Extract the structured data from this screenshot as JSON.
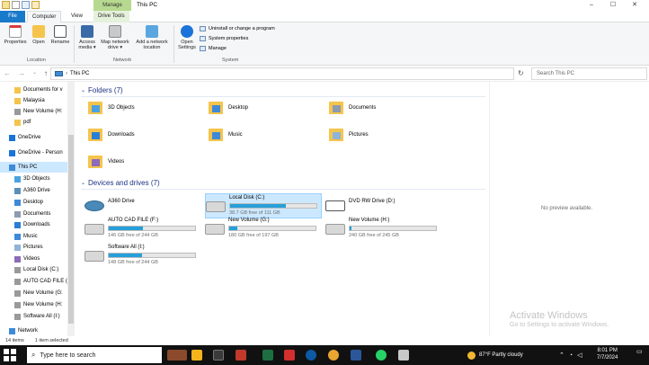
{
  "window": {
    "title": "This PC",
    "context_tab": "Manage",
    "controls": [
      "–",
      "☐",
      "✕"
    ]
  },
  "tabs": {
    "file": "File",
    "computer": "Computer",
    "view": "View",
    "drive_tools": "Drive Tools"
  },
  "ribbon": {
    "location": {
      "label": "Location",
      "properties": "Properties",
      "open": "Open",
      "rename": "Rename"
    },
    "network": {
      "label": "Network",
      "access_media": "Access media ▾",
      "map_drive": "Map network drive ▾",
      "add_location": "Add a network location"
    },
    "system": {
      "label": "System",
      "open_settings": "Open Settings",
      "uninstall": "Uninstall or change a program",
      "system_properties": "System properties",
      "manage": "Manage"
    }
  },
  "address": {
    "path": "This PC",
    "search_placeholder": "Search This PC"
  },
  "nav": {
    "items": [
      {
        "label": "Documents for v",
        "color": "#f5c44c"
      },
      {
        "label": "Malaysia",
        "color": "#f5c44c"
      },
      {
        "label": "New Volume (H:",
        "color": "#9a9a9a"
      },
      {
        "label": "pdf",
        "color": "#f5c44c"
      },
      {
        "label": "OneDrive",
        "color": "#1a73d9"
      },
      {
        "label": "OneDrive - Person",
        "color": "#1a73d9"
      },
      {
        "label": "This PC",
        "color": "#3f8ad8"
      },
      {
        "label": "3D Objects",
        "color": "#4aa3e0"
      },
      {
        "label": "A360 Drive",
        "color": "#5b8fb8"
      },
      {
        "label": "Desktop",
        "color": "#3f8ad8"
      },
      {
        "label": "Documents",
        "color": "#8c9bb0"
      },
      {
        "label": "Downloads",
        "color": "#2a7fd4"
      },
      {
        "label": "Music",
        "color": "#3f8ad8"
      },
      {
        "label": "Pictures",
        "color": "#8fb4d8"
      },
      {
        "label": "Videos",
        "color": "#8c6bb8"
      },
      {
        "label": "Local Disk (C:)",
        "color": "#9a9a9a"
      },
      {
        "label": "AUTO CAD FILE (",
        "color": "#9a9a9a"
      },
      {
        "label": "New Volume (G:",
        "color": "#9a9a9a"
      },
      {
        "label": "New Volume (H:",
        "color": "#9a9a9a"
      },
      {
        "label": "Software All (I:)",
        "color": "#9a9a9a"
      },
      {
        "label": "Network",
        "color": "#3f8ad8"
      }
    ]
  },
  "folders": {
    "header": "Folders (7)",
    "items": [
      "3D Objects",
      "Desktop",
      "Documents",
      "Downloads",
      "Music",
      "Pictures",
      "Videos"
    ]
  },
  "drives": {
    "header": "Devices and drives (7)",
    "items": [
      {
        "name": "A360 Drive",
        "free": "",
        "fill": null
      },
      {
        "name": "Local Disk (C:)",
        "free": "38.7 GB free of 111 GB",
        "fill": 0.65
      },
      {
        "name": "DVD RW Drive (D:)",
        "free": "",
        "fill": null
      },
      {
        "name": "AUTO CAD FILE (F:)",
        "free": "146 GB free of 244 GB",
        "fill": 0.4
      },
      {
        "name": "New Volume (G:)",
        "free": "180 GB free of 197 GB",
        "fill": 0.09
      },
      {
        "name": "New Volume (H:)",
        "free": "240 GB free of 245 GB",
        "fill": 0.02
      },
      {
        "name": "Software All (I:)",
        "free": "148 GB free of 244 GB",
        "fill": 0.39
      }
    ]
  },
  "preview": {
    "text": "No preview available."
  },
  "activation": {
    "line1": "Activate Windows",
    "line2": "Go to Settings to activate Windows."
  },
  "status": {
    "count": "14 items",
    "selected": "1 item selected"
  },
  "taskbar": {
    "search_placeholder": "Type here to search",
    "weather": "87°F  Partly cloudy",
    "time": "8:01 PM",
    "date": "7/7/2024"
  }
}
